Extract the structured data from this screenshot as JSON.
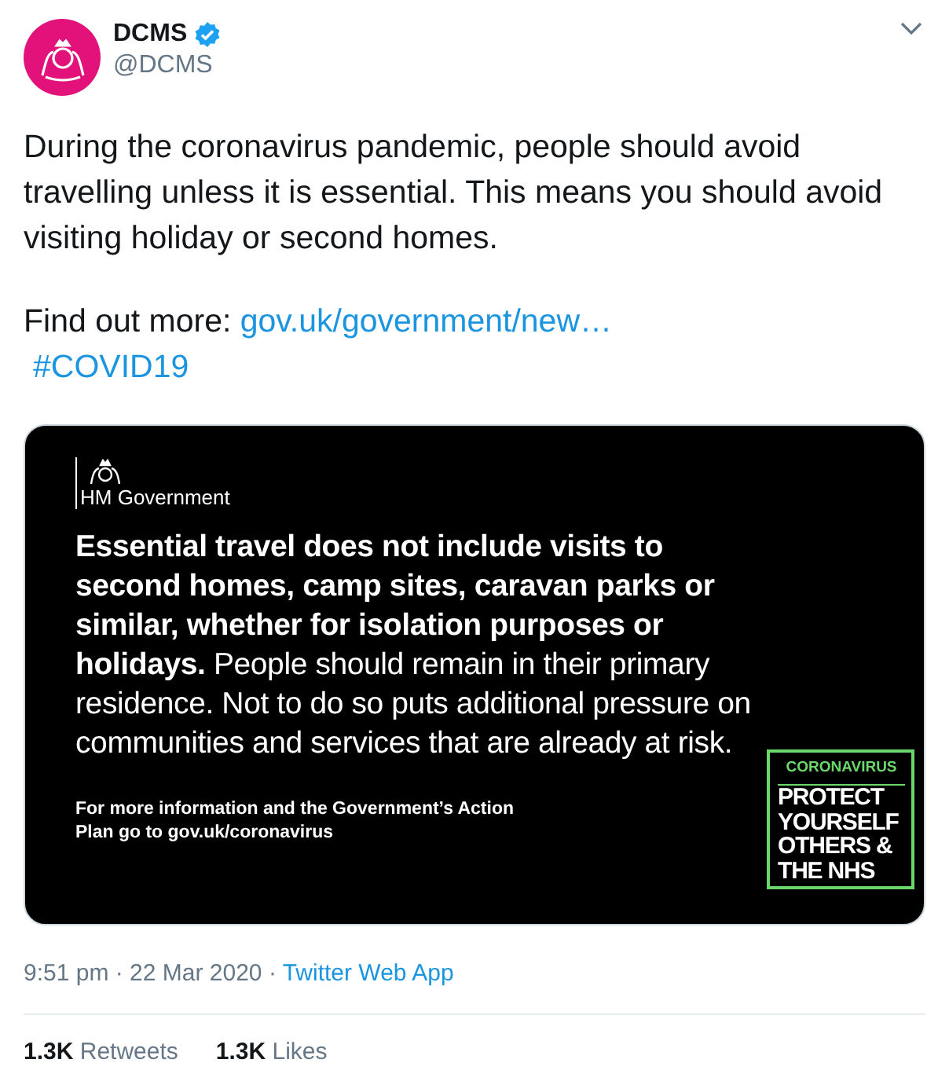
{
  "account": {
    "name": "DCMS",
    "handle": "@DCMS",
    "verified": true
  },
  "tweet": {
    "text": "During the coronavirus pandemic, people should avoid travelling unless it is essential. This means you should avoid visiting holiday or second homes.",
    "more_label": "Find out more:",
    "link": "gov.uk/government/new…",
    "hashtag": "#COVID19"
  },
  "card": {
    "brand": "HM Government",
    "message": "**Essential travel does not include visits to second homes, camp sites, caravan parks or similar, whether for isolation purposes or holidays.** People should remain in their primary residence. Not to do so puts additional pressure on communities and services that are already at risk.",
    "footer": "For more information and the Government’s Action Plan go to **gov.uk/coronavirus**",
    "badge_title": "CORONAVIRUS",
    "badge_lines": [
      "PROTECT",
      "YOURSELF",
      "OTHERS &",
      "THE NHS"
    ]
  },
  "meta": {
    "timestamp": "9:51 pm · 22 Mar 2020",
    "separator": "·",
    "source": "Twitter Web App"
  },
  "stats": [
    {
      "count": "1.3K",
      "label": "Retweets"
    },
    {
      "count": "1.3K",
      "label": "Likes"
    }
  ]
}
